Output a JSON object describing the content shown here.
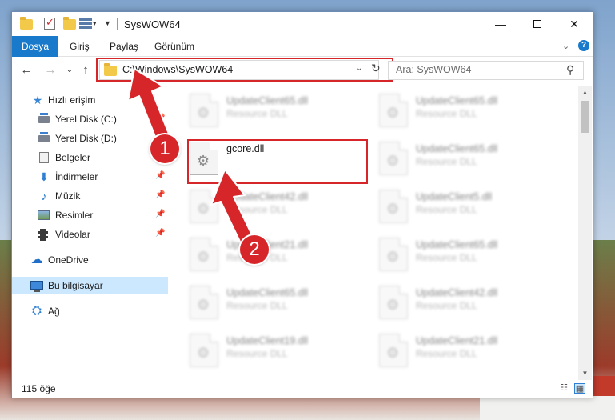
{
  "window": {
    "title": "SysWOW64"
  },
  "ribbon": {
    "tabs": [
      "Dosya",
      "Giriş",
      "Paylaş",
      "Görünüm"
    ]
  },
  "nav": {
    "address": "C:\\Windows\\SysWOW64",
    "search_placeholder": "Ara: SysWOW64"
  },
  "sidebar": {
    "items": [
      {
        "label": "Hızlı erişim"
      },
      {
        "label": "Yerel Disk (C:)"
      },
      {
        "label": "Yerel Disk (D:)"
      },
      {
        "label": "Belgeler"
      },
      {
        "label": "İndirmeler"
      },
      {
        "label": "Müzik"
      },
      {
        "label": "Resimler"
      },
      {
        "label": "Videolar"
      },
      {
        "label": "OneDrive"
      },
      {
        "label": "Bu bilgisayar"
      },
      {
        "label": "Ağ"
      }
    ]
  },
  "files": {
    "highlighted": {
      "name": "gcore.dll"
    },
    "left": [
      {
        "name": "UpdateClient65.dll",
        "type": "Resource DLL"
      },
      {
        "name": "UpdateClient42.dll",
        "type": "Resource DLL"
      },
      {
        "name": "UpdateClient21.dll",
        "type": "Resource DLL"
      },
      {
        "name": "UpdateClient65.dll",
        "type": "Resource DLL"
      },
      {
        "name": "UpdateClient19.dll",
        "type": "Resource DLL"
      }
    ],
    "right": [
      {
        "name": "UpdateClient65.dll",
        "type": "Resource DLL"
      },
      {
        "name": "UpdateClient65.dll",
        "type": "Resource DLL"
      },
      {
        "name": "UpdateClient5.dll",
        "type": "Resource DLL"
      },
      {
        "name": "UpdateClient65.dll",
        "type": "Resource DLL"
      },
      {
        "name": "UpdateClient42.dll",
        "type": "Resource DLL"
      },
      {
        "name": "UpdateClient21.dll",
        "type": "Resource DLL"
      }
    ]
  },
  "status": {
    "count": "115 öğe"
  },
  "callouts": [
    "1",
    "2"
  ],
  "colors": {
    "accent": "#1979ca",
    "highlight": "#d7262a",
    "selection": "#cce8ff"
  }
}
